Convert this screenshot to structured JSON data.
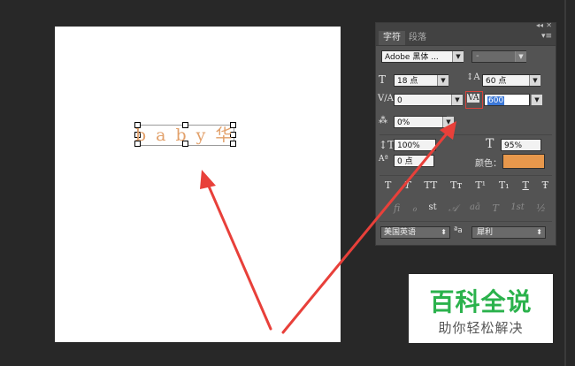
{
  "document": {
    "text_letters": [
      "b",
      "a",
      "b",
      "y",
      "华"
    ]
  },
  "panel": {
    "tabs": [
      {
        "label": "字符"
      },
      {
        "label": "段落"
      }
    ],
    "font_family": "Adobe 黑体 ...",
    "font_style": "-",
    "font_size": "18 点",
    "leading": "60 点",
    "kerning": "0",
    "tracking": "600",
    "tsume": "0%",
    "vertical_scale": "100%",
    "horizontal_scale": "95%",
    "baseline_shift": "0 点",
    "color_label": "颜色：",
    "color_value": "#e8984c",
    "style_buttons": [
      "T",
      "T",
      "TT",
      "Tт",
      "T¹",
      "T₁",
      "T",
      "Ŧ"
    ],
    "opentype_buttons": [
      "ﬁ",
      "ℴ",
      "st",
      "𝒜",
      "aā",
      "T",
      "1st",
      "½"
    ],
    "language": "美国英语",
    "aa_label": "ªa",
    "antialias": "犀利"
  },
  "watermark": {
    "title": "百科全说",
    "subtitle": "助你轻松解决"
  },
  "colors": {
    "accent_arrow": "#e8403a",
    "text_color": "#e2a06a",
    "watermark_green": "#2bb24c"
  }
}
